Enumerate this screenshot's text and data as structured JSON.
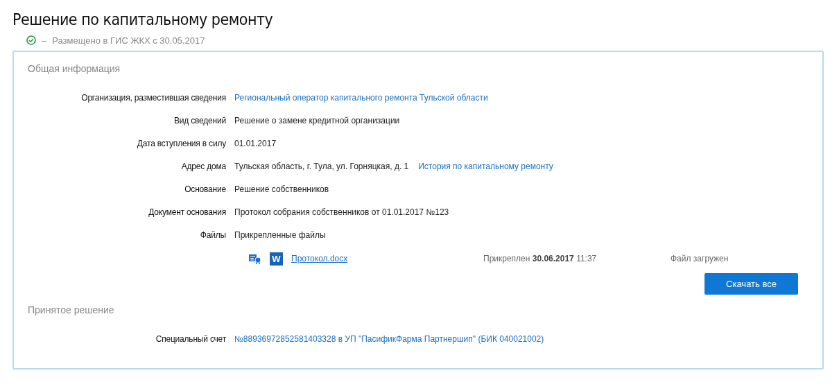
{
  "title": "Решение по капитальному ремонту",
  "status": {
    "dash": "–",
    "text": "Размещено в ГИС ЖКХ с 30.05.2017"
  },
  "sections": [
    {
      "heading": "Общая информация",
      "rows": [
        {
          "label": "Организация, разместившая сведения",
          "value": "Региональный оператор капитального ремонта Тульской области",
          "kind": "link"
        },
        {
          "label": "Вид сведений",
          "value": "Решение о замене кредитной организации",
          "kind": "text"
        },
        {
          "label": "Дата вступления в силу",
          "value": "01.01.2017",
          "kind": "text"
        },
        {
          "label": "Адрес дома",
          "value": "Тульская область, г. Тула, ул. Горняцкая, д. 1",
          "kind": "text",
          "link": "История по капитальному ремонту"
        },
        {
          "label": "Основание",
          "value": "Решение собственников",
          "kind": "text"
        },
        {
          "label": "Документ основания",
          "value": "Протокол собрания собственников от 01.01.2017 №123",
          "kind": "text"
        },
        {
          "label": "Файлы",
          "value": "Прикрепленные файлы",
          "kind": "text"
        }
      ],
      "files": [
        {
          "name": "Протокол.docx",
          "type_badge": "W",
          "attached": "Прикреплен **30.06.2017**  11:37",
          "status": "Файл загружен"
        }
      ],
      "button": "Скачать все"
    },
    {
      "heading": "Принятое решение",
      "rows": [
        {
          "label": "Специальный счет",
          "value": "№88936972852581403328 в УП \"ПасификФарма Партнершип\" (БИК 040021002)",
          "kind": "link"
        }
      ]
    }
  ]
}
